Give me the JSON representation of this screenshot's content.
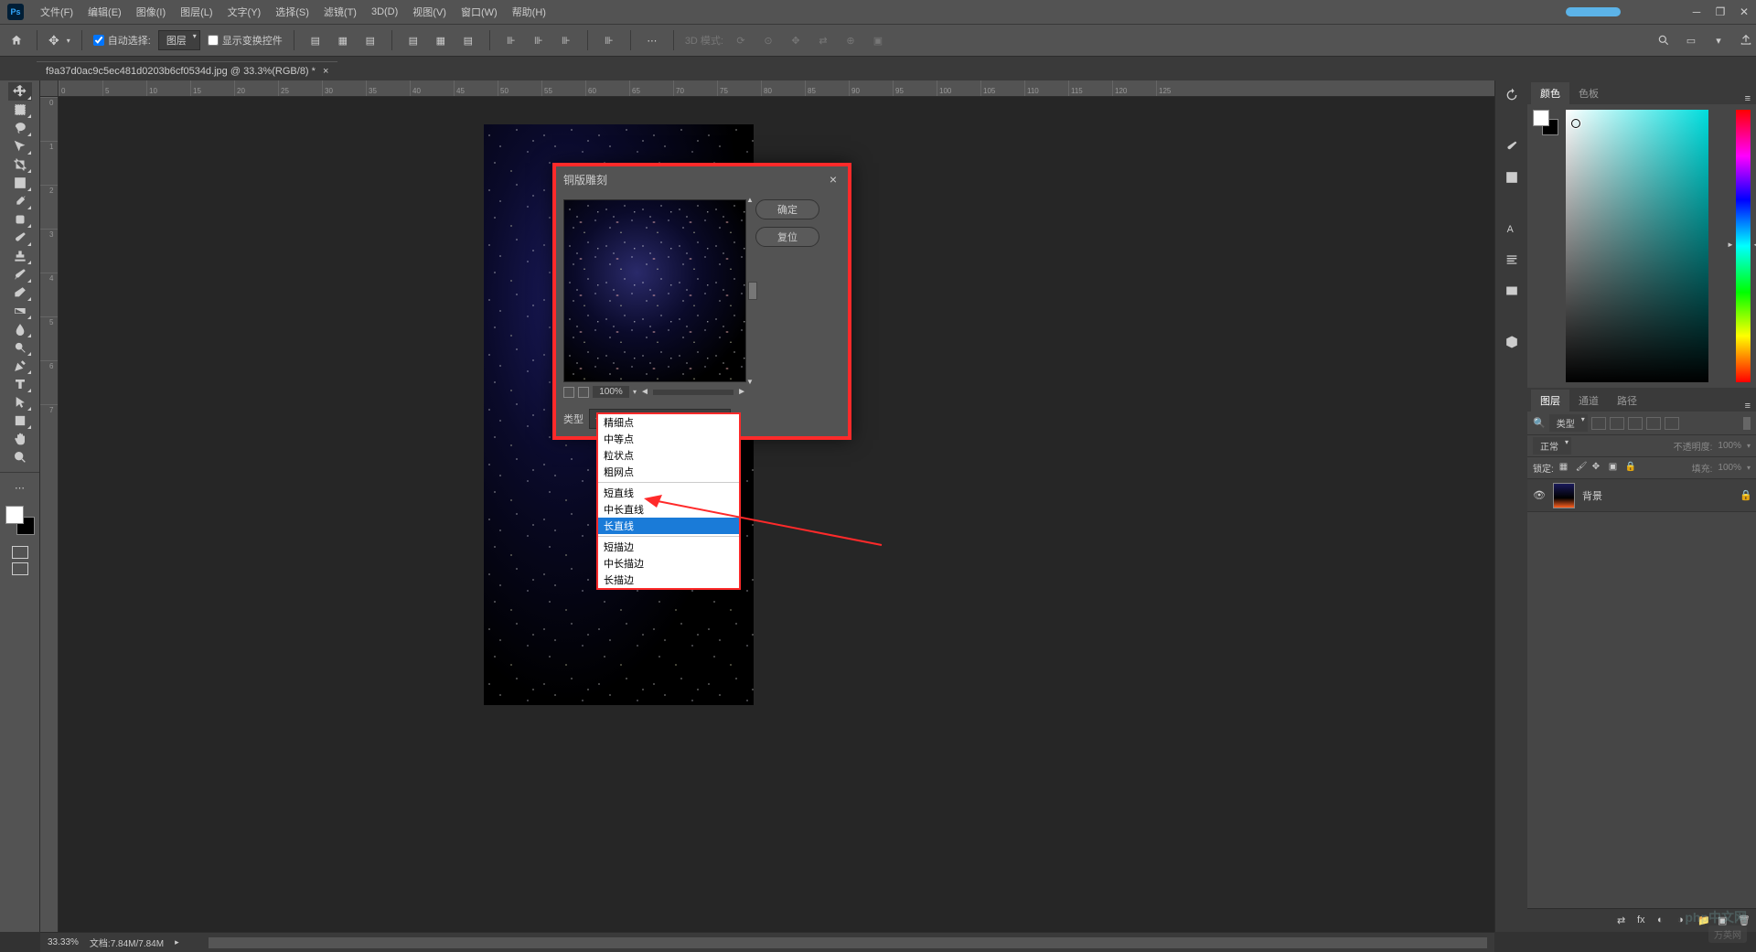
{
  "menubar": {
    "ps": "Ps",
    "items": [
      "文件(F)",
      "编辑(E)",
      "图像(I)",
      "图层(L)",
      "文字(Y)",
      "选择(S)",
      "滤镜(T)",
      "3D(D)",
      "视图(V)",
      "窗口(W)",
      "帮助(H)"
    ]
  },
  "optionsbar": {
    "auto_select": "自动选择:",
    "auto_select_target": "图层",
    "show_transform": "显示变换控件",
    "mode3d_label": "3D 模式:"
  },
  "tabbar": {
    "doc_title": "f9a37d0ac9c5ec481d0203b6cf0534d.jpg @ 33.3%(RGB/8) *"
  },
  "ruler_h": [
    0,
    5,
    10,
    15,
    20,
    25,
    30,
    35,
    40,
    45,
    50,
    55,
    60,
    65,
    70,
    75,
    80,
    85,
    90,
    95,
    100,
    105,
    110,
    115,
    120,
    125
  ],
  "ruler_v": [
    0,
    1,
    2,
    3,
    4,
    5,
    6,
    7
  ],
  "dialog": {
    "title": "铜版雕刻",
    "ok": "确定",
    "reset": "复位",
    "zoom": "100%",
    "type_label": "类型",
    "type_selected": "长直线"
  },
  "dropdown": {
    "options": [
      "精细点",
      "中等点",
      "粒状点",
      "粗网点",
      "短直线",
      "中长直线",
      "长直线",
      "短描边",
      "中长描边",
      "长描边"
    ],
    "highlighted": "长直线"
  },
  "panels": {
    "color_tab": "颜色",
    "swatches_tab": "色板",
    "layers_tab": "图层",
    "channels_tab": "通道",
    "paths_tab": "路径",
    "filter_label": "类型",
    "blend_mode": "正常",
    "opacity_label": "不透明度:",
    "opacity_value": "100%",
    "lock_label": "锁定:",
    "fill_label": "填充:",
    "fill_value": "100%",
    "layer_name": "背景"
  },
  "statusbar": {
    "zoom": "33.33%",
    "doc_info": "文档:7.84M/7.84M"
  },
  "watermarks": {
    "w1": "php中文网",
    "w2": "万英网"
  }
}
